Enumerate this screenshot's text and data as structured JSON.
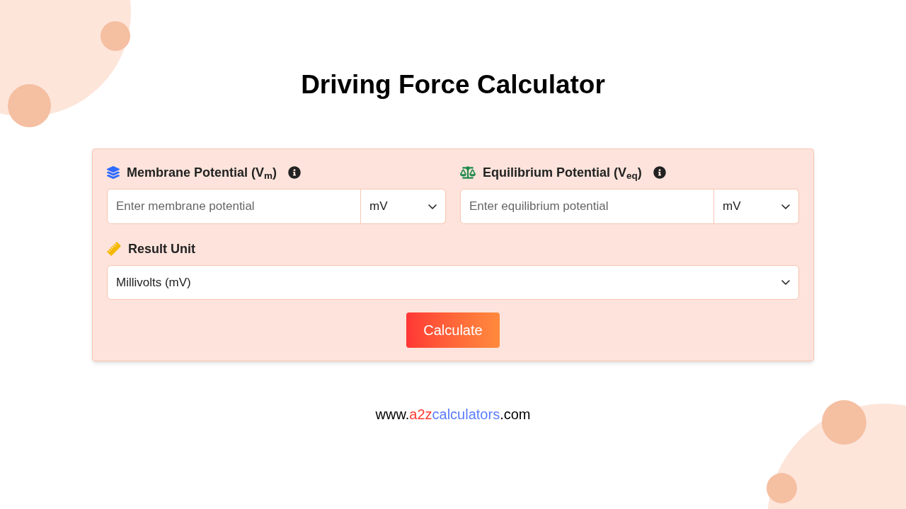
{
  "title": "Driving Force Calculator",
  "inputs": [
    {
      "kind": "layers",
      "label": "Membrane Potential (V$_{m}$)",
      "placeholder": "Enter membrane potential",
      "unit": "mV"
    },
    {
      "kind": "scale",
      "label": "Equilibrium Potential (V$_{eq}$)",
      "placeholder": "Enter equilibrium potential",
      "unit": "mV"
    }
  ],
  "result_unit": {
    "kind": "ruler",
    "label": "Result Unit",
    "value": "Millivolts (mV)"
  },
  "button": "Calculate",
  "footer_url": [
    {
      "text": "www.",
      "color": "#000000"
    },
    {
      "text": "a2z",
      "color": "#ff3b30"
    },
    {
      "text": "calculators",
      "color": "#5b7cff"
    },
    {
      "text": ".com",
      "color": "#000000"
    }
  ]
}
